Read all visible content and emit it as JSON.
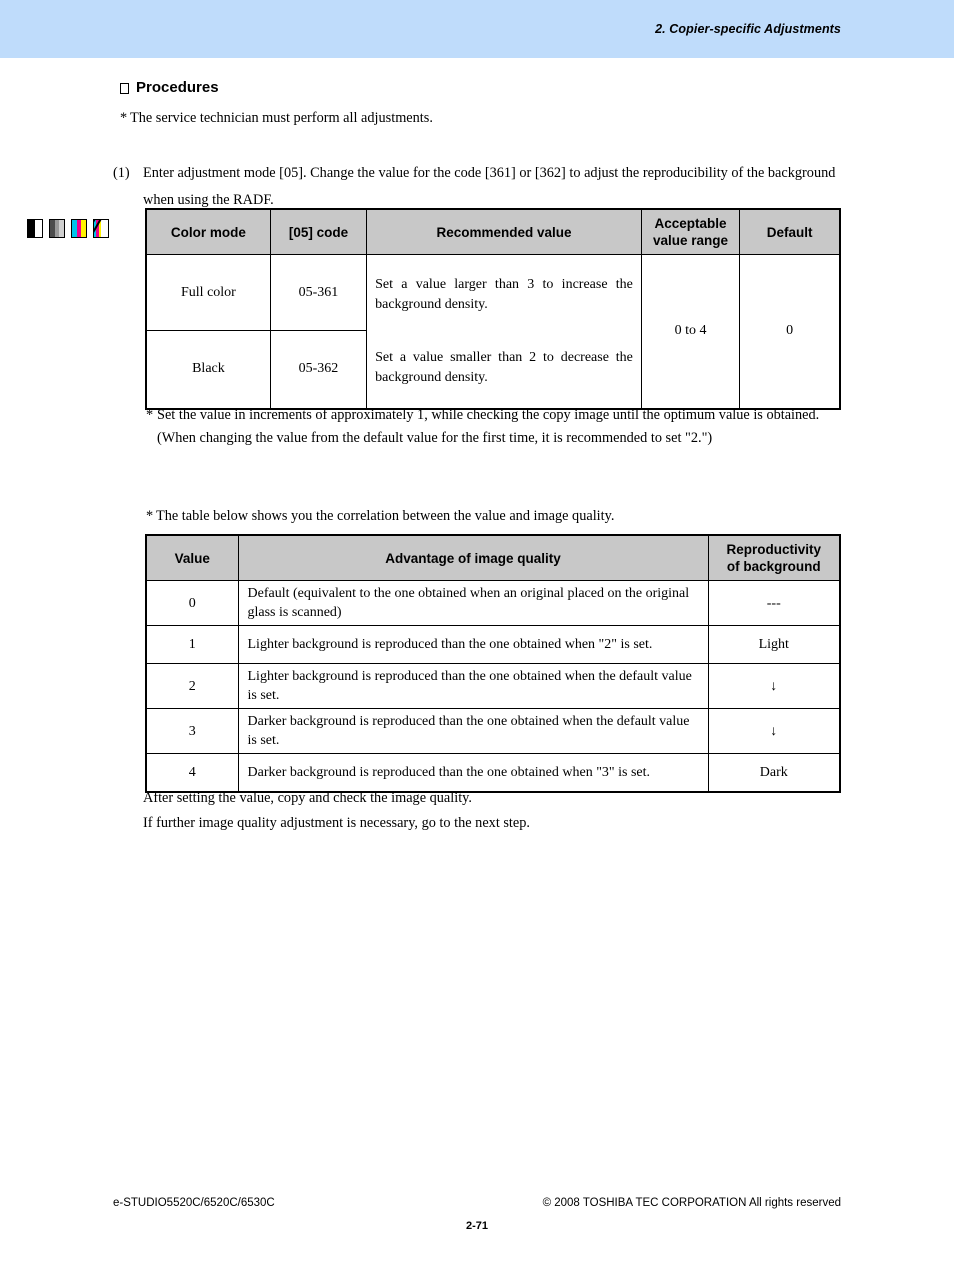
{
  "header": {
    "chapter_title": "2. Copier-specific Adjustments",
    "banner_color": "#bfdcfb"
  },
  "section": {
    "heading": "Procedures",
    "note_technician_star": "*",
    "note_technician": "The service technician must perform all adjustments."
  },
  "mode_icons": [
    {
      "name": "black-white-mode-icon",
      "label": "Black and white mode"
    },
    {
      "name": "grayscale-mode-icon",
      "label": "Grayscale mode"
    },
    {
      "name": "full-color-mode-icon",
      "label": "Full color mode"
    },
    {
      "name": "twin-color-mode-icon",
      "label": "Twin color mode"
    }
  ],
  "step1": {
    "number": "(1)",
    "text": "Enter adjustment mode [05]. Change the value for the code [361] or [362] to adjust the reproducibility of the background when using the RADF."
  },
  "table_adjust": {
    "headers": [
      "Color mode",
      "[05] code",
      "Recommended value",
      "Acceptable value range",
      "Default"
    ],
    "rows": [
      {
        "color_mode": "Full color",
        "code": "05-361"
      },
      {
        "color_mode": "Black",
        "code": "05-362"
      }
    ],
    "recommended_value_line1": "Set a value larger than 3 to increase the background density.",
    "recommended_value_line2": "Set a value smaller than 2 to decrease the background density.",
    "acceptable_range": "0 to 4",
    "default": "0"
  },
  "note_increments": {
    "star": "*",
    "text": "Set the value in increments of approximately 1, while checking the copy image until the optimum value is obtained.  (When changing the value from the default value for the first time, it is recommended to set \"2.\")"
  },
  "note_correlation": {
    "star": "*",
    "text": "The table below shows you the correlation between the value and image quality."
  },
  "table_quality": {
    "headers": [
      "Value",
      "Advantage of image quality",
      "Reproductivity of background"
    ],
    "headers_split": {
      "col3_line1": "Reproductivity",
      "col3_line2": "of background"
    },
    "rows": [
      {
        "value": "0",
        "advantage": "Default (equivalent to the one obtained when an original placed on the original glass is scanned)",
        "reproductivity": "---"
      },
      {
        "value": "1",
        "advantage": "Lighter background is reproduced than the one obtained when \"2\" is set.",
        "reproductivity": "Light"
      },
      {
        "value": "2",
        "advantage": "Lighter background is reproduced than the one obtained when the default value is set.",
        "reproductivity": "↓"
      },
      {
        "value": "3",
        "advantage": "Darker background is reproduced than the one obtained when the default value is set.",
        "reproductivity": "↓"
      },
      {
        "value": "4",
        "advantage": "Darker background is reproduced than the one obtained when \"3\" is set.",
        "reproductivity": "Dark"
      }
    ]
  },
  "closing": {
    "line1": "After setting the value, copy and check the image quality.",
    "line2": "If further image quality adjustment is necessary, go to the next step."
  },
  "footer": {
    "model": "e-STUDIO5520C/6520C/6530C",
    "copyright": "© 2008 TOSHIBA TEC CORPORATION All rights reserved",
    "page_number": "2-71"
  }
}
